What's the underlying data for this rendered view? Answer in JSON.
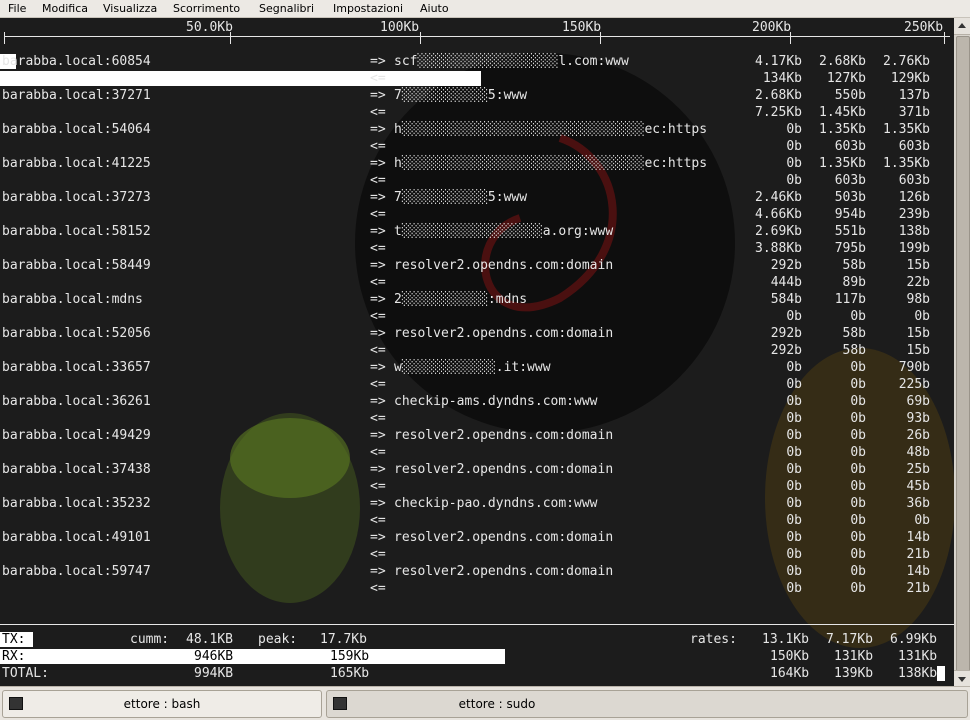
{
  "menubar": {
    "items": [
      "File",
      "Modifica",
      "Visualizza",
      "Scorrimento",
      "Segnalibri",
      "Impostazioni",
      "Aiuto"
    ]
  },
  "scale": {
    "labels": [
      "50.0Kb",
      "100Kb",
      "150Kb",
      "200Kb",
      "250Kb"
    ]
  },
  "connections": [
    {
      "src": "barabba.local:60854",
      "dst": "scf░░░░░░░░░░░░░░░░░░l.com:www",
      "tx": [
        "4.17Kb",
        "2.68Kb",
        "2.76Kb"
      ],
      "rx": [
        "134Kb",
        "127Kb",
        "129Kb"
      ]
    },
    {
      "src": "barabba.local:37271",
      "dst": "7░░░░░░░░░░░5:www",
      "tx": [
        "2.68Kb",
        "550b",
        "137b"
      ],
      "rx": [
        "7.25Kb",
        "1.45Kb",
        "371b"
      ]
    },
    {
      "src": "barabba.local:54064",
      "dst": "h░░░░░░░░░░░░░░░░░░░░░░░░░░░░░░░ec:https",
      "tx": [
        "0b",
        "1.35Kb",
        "1.35Kb"
      ],
      "rx": [
        "0b",
        "603b",
        "603b"
      ]
    },
    {
      "src": "barabba.local:41225",
      "dst": "h░░░░░░░░░░░░░░░░░░░░░░░░░░░░░░░ec:https",
      "tx": [
        "0b",
        "1.35Kb",
        "1.35Kb"
      ],
      "rx": [
        "0b",
        "603b",
        "603b"
      ]
    },
    {
      "src": "barabba.local:37273",
      "dst": "7░░░░░░░░░░░5:www",
      "tx": [
        "2.46Kb",
        "503b",
        "126b"
      ],
      "rx": [
        "4.66Kb",
        "954b",
        "239b"
      ]
    },
    {
      "src": "barabba.local:58152",
      "dst": "t░░░░░░░░░░░░░░░░░░a.org:www",
      "tx": [
        "2.69Kb",
        "551b",
        "138b"
      ],
      "rx": [
        "3.88Kb",
        "795b",
        "199b"
      ]
    },
    {
      "src": "barabba.local:58449",
      "dst": "resolver2.opendns.com:domain",
      "tx": [
        "292b",
        "58b",
        "15b"
      ],
      "rx": [
        "444b",
        "89b",
        "22b"
      ]
    },
    {
      "src": "barabba.local:mdns",
      "dst": "2░░░░░░░░░░░:mdns",
      "tx": [
        "584b",
        "117b",
        "98b"
      ],
      "rx": [
        "0b",
        "0b",
        "0b"
      ]
    },
    {
      "src": "barabba.local:52056",
      "dst": "resolver2.opendns.com:domain",
      "tx": [
        "292b",
        "58b",
        "15b"
      ],
      "rx": [
        "292b",
        "58b",
        "15b"
      ]
    },
    {
      "src": "barabba.local:33657",
      "dst": "w░░░░░░░░░░░░.it:www",
      "tx": [
        "0b",
        "0b",
        "790b"
      ],
      "rx": [
        "0b",
        "0b",
        "225b"
      ]
    },
    {
      "src": "barabba.local:36261",
      "dst": "checkip-ams.dyndns.com:www",
      "tx": [
        "0b",
        "0b",
        "69b"
      ],
      "rx": [
        "0b",
        "0b",
        "93b"
      ]
    },
    {
      "src": "barabba.local:49429",
      "dst": "resolver2.opendns.com:domain",
      "tx": [
        "0b",
        "0b",
        "26b"
      ],
      "rx": [
        "0b",
        "0b",
        "48b"
      ]
    },
    {
      "src": "barabba.local:37438",
      "dst": "resolver2.opendns.com:domain",
      "tx": [
        "0b",
        "0b",
        "25b"
      ],
      "rx": [
        "0b",
        "0b",
        "45b"
      ]
    },
    {
      "src": "barabba.local:35232",
      "dst": "checkip-pao.dyndns.com:www",
      "tx": [
        "0b",
        "0b",
        "36b"
      ],
      "rx": [
        "0b",
        "0b",
        "0b"
      ]
    },
    {
      "src": "barabba.local:49101",
      "dst": "resolver2.opendns.com:domain",
      "tx": [
        "0b",
        "0b",
        "14b"
      ],
      "rx": [
        "0b",
        "0b",
        "21b"
      ]
    },
    {
      "src": "barabba.local:59747",
      "dst": "resolver2.opendns.com:domain",
      "tx": [
        "0b",
        "0b",
        "14b"
      ],
      "rx": [
        "0b",
        "0b",
        "21b"
      ]
    }
  ],
  "arrows": {
    "out": "=>",
    "in": "<="
  },
  "totals": {
    "tx": {
      "label": "TX:",
      "cumm_label": "cumm:",
      "cumm": "48.1KB",
      "peak_label": "peak:",
      "peak": "17.7Kb",
      "rates_label": "rates:",
      "rates": [
        "13.1Kb",
        "7.17Kb",
        "6.99Kb"
      ]
    },
    "rx": {
      "label": "RX:",
      "cumm": "946KB",
      "peak": "159Kb",
      "rates": [
        "150Kb",
        "131Kb",
        "131Kb"
      ]
    },
    "total": {
      "label": "TOTAL:",
      "cumm": "994KB",
      "peak": "165Kb",
      "rates": [
        "164Kb",
        "139Kb",
        "138Kb"
      ]
    }
  },
  "taskbar": {
    "tabs": [
      "ettore : bash",
      "ettore : sudo"
    ]
  }
}
